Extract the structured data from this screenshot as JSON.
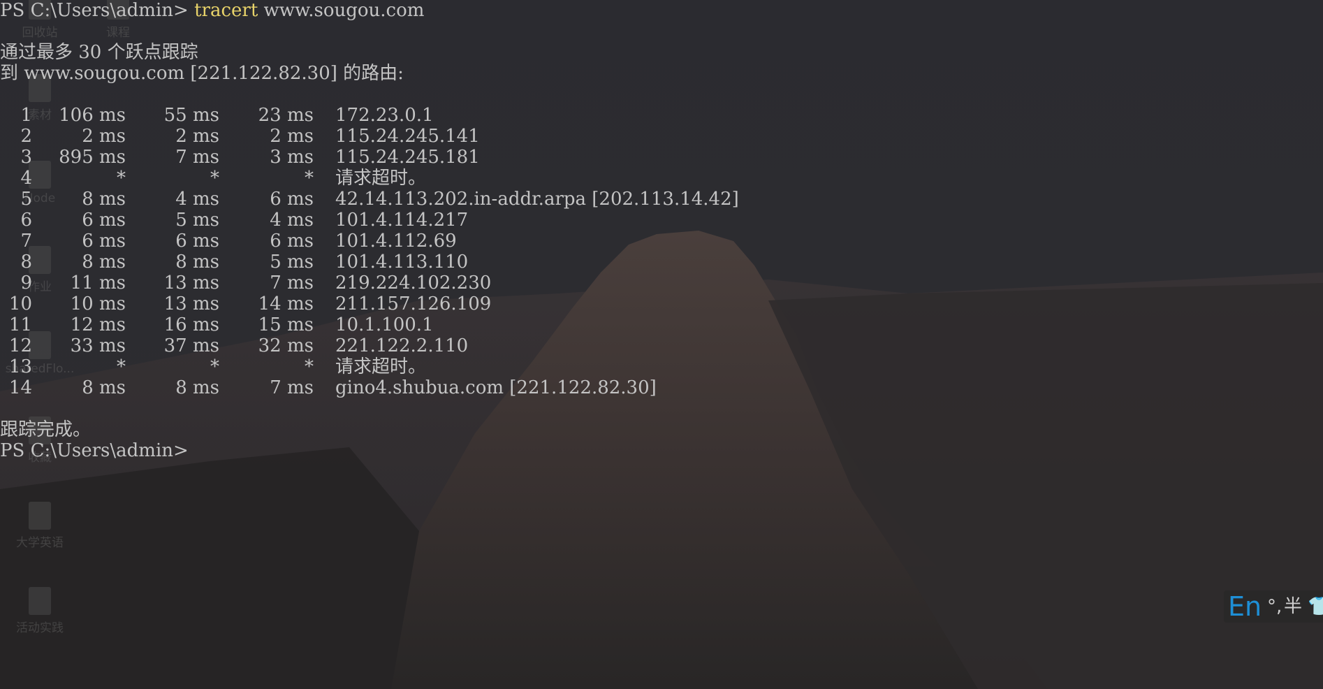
{
  "terminal": {
    "prompt": "PS C:\\Users\\admin>",
    "command": "tracert",
    "command_arg": "www.sougou.com",
    "header_line1": "通过最多 30 个跃点跟踪",
    "header_line2": "到 www.sougou.com [221.122.82.30] 的路由:",
    "hops": [
      {
        "hop": "1",
        "rtt1": "106 ms",
        "rtt2": "55 ms",
        "rtt3": "23 ms",
        "host": "172.23.0.1"
      },
      {
        "hop": "2",
        "rtt1": "2 ms",
        "rtt2": "2 ms",
        "rtt3": "2 ms",
        "host": "115.24.245.141"
      },
      {
        "hop": "3",
        "rtt1": "895 ms",
        "rtt2": "7 ms",
        "rtt3": "3 ms",
        "host": "115.24.245.181"
      },
      {
        "hop": "4",
        "rtt1": "*",
        "rtt2": "*",
        "rtt3": "*",
        "host": "请求超时。"
      },
      {
        "hop": "5",
        "rtt1": "8 ms",
        "rtt2": "4 ms",
        "rtt3": "6 ms",
        "host": "42.14.113.202.in-addr.arpa [202.113.14.42]"
      },
      {
        "hop": "6",
        "rtt1": "6 ms",
        "rtt2": "5 ms",
        "rtt3": "4 ms",
        "host": "101.4.114.217"
      },
      {
        "hop": "7",
        "rtt1": "6 ms",
        "rtt2": "6 ms",
        "rtt3": "6 ms",
        "host": "101.4.112.69"
      },
      {
        "hop": "8",
        "rtt1": "8 ms",
        "rtt2": "8 ms",
        "rtt3": "5 ms",
        "host": "101.4.113.110"
      },
      {
        "hop": "9",
        "rtt1": "11 ms",
        "rtt2": "13 ms",
        "rtt3": "7 ms",
        "host": "219.224.102.230"
      },
      {
        "hop": "10",
        "rtt1": "10 ms",
        "rtt2": "13 ms",
        "rtt3": "14 ms",
        "host": "211.157.126.109"
      },
      {
        "hop": "11",
        "rtt1": "12 ms",
        "rtt2": "16 ms",
        "rtt3": "15 ms",
        "host": "10.1.100.1"
      },
      {
        "hop": "12",
        "rtt1": "33 ms",
        "rtt2": "37 ms",
        "rtt3": "32 ms",
        "host": "221.122.2.110"
      },
      {
        "hop": "13",
        "rtt1": "*",
        "rtt2": "*",
        "rtt3": "*",
        "host": "请求超时。"
      },
      {
        "hop": "14",
        "rtt1": "8 ms",
        "rtt2": "8 ms",
        "rtt3": "7 ms",
        "host": "gino4.shubua.com [221.122.82.30]"
      }
    ],
    "footer": "跟踪完成。",
    "final_prompt": "PS C:\\Users\\admin>"
  },
  "desktop_icons": [
    {
      "label": "回收站",
      "icon": "recycle-bin-icon"
    },
    {
      "label": "课程",
      "icon": "folder-icon"
    },
    {
      "label": "素材",
      "icon": "folder-icon"
    },
    {
      "label": "Node",
      "icon": "app-icon"
    },
    {
      "label": "作业",
      "icon": "folder-icon"
    },
    {
      "label": "sharedFlo...",
      "icon": "file-icon"
    },
    {
      "label": "收藏",
      "icon": "folder-icon"
    },
    {
      "label": "大学英语",
      "icon": "document-icon"
    },
    {
      "label": "活动实践",
      "icon": "document-icon"
    }
  ],
  "ime": {
    "language": "En",
    "punctuation": "°,",
    "width": "半",
    "settings_icon": "shirt-icon"
  },
  "colors": {
    "command": "#e8d36a",
    "text": "#c4c4c4",
    "ime_lang": "#1e8fd6"
  }
}
